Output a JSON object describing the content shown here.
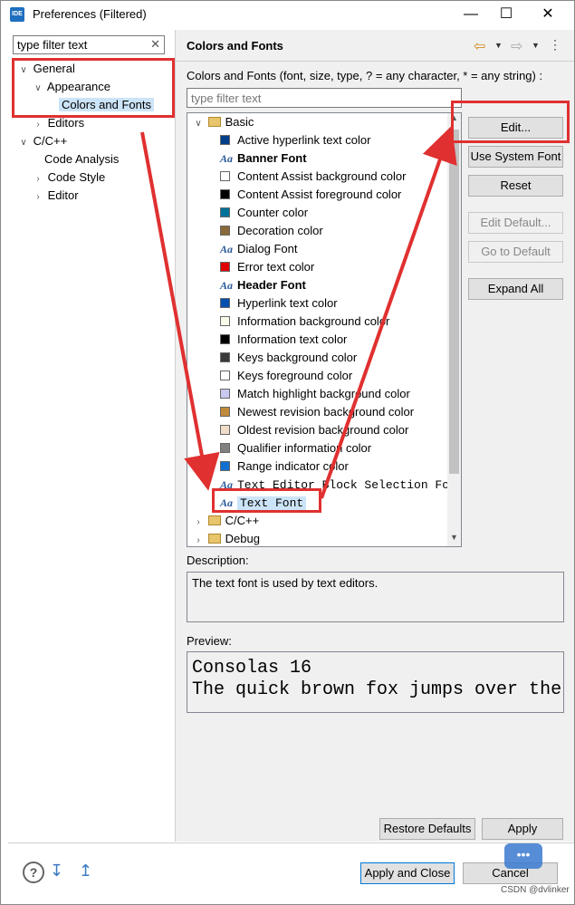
{
  "window": {
    "title": "Preferences (Filtered)",
    "icon_text": "IDE"
  },
  "left": {
    "filter_value": "type filter text",
    "tree": [
      {
        "label": "General",
        "level": 0,
        "expanded": true
      },
      {
        "label": "Appearance",
        "level": 1,
        "expanded": true
      },
      {
        "label": "Colors and Fonts",
        "level": 2,
        "selected": true
      },
      {
        "label": "Editors",
        "level": 1,
        "expanded": false
      },
      {
        "label": "C/C++",
        "level": 0,
        "expanded": true
      },
      {
        "label": "Code Analysis",
        "level": 1
      },
      {
        "label": "Code Style",
        "level": 1,
        "expanded": false
      },
      {
        "label": "Editor",
        "level": 1,
        "expanded": false
      }
    ]
  },
  "right": {
    "header": "Colors and Fonts",
    "subtitle": "Colors and Fonts (font, size, type, ? = any character, * = any string) :",
    "filter_placeholder": "type filter text",
    "basic_label": "Basic",
    "items": [
      {
        "label": "Active hyperlink text color",
        "type": "color",
        "color": "#003f8a"
      },
      {
        "label": "Banner Font",
        "type": "font",
        "bold": true
      },
      {
        "label": "Content Assist background color",
        "type": "color",
        "color": "#ffffff"
      },
      {
        "label": "Content Assist foreground color",
        "type": "color",
        "color": "#000000"
      },
      {
        "label": "Counter color",
        "type": "color",
        "color": "#00729a"
      },
      {
        "label": "Decoration color",
        "type": "color",
        "color": "#8a6a3a"
      },
      {
        "label": "Dialog Font",
        "type": "font"
      },
      {
        "label": "Error text color",
        "type": "color",
        "color": "#e00000"
      },
      {
        "label": "Header Font",
        "type": "font",
        "bold": true
      },
      {
        "label": "Hyperlink text color",
        "type": "color",
        "color": "#0050b0"
      },
      {
        "label": "Information background color",
        "type": "color",
        "color": "#fafae8"
      },
      {
        "label": "Information text color",
        "type": "color",
        "color": "#000000"
      },
      {
        "label": "Keys background color",
        "type": "color",
        "color": "#3a3a3a"
      },
      {
        "label": "Keys foreground color",
        "type": "color",
        "color": "#ffffff"
      },
      {
        "label": "Match highlight background color",
        "type": "color",
        "color": "#c8c8f0"
      },
      {
        "label": "Newest revision background color",
        "type": "color",
        "color": "#c08a3a"
      },
      {
        "label": "Oldest revision background color",
        "type": "color",
        "color": "#f0dcc8"
      },
      {
        "label": "Qualifier information color",
        "type": "color",
        "color": "#808080"
      },
      {
        "label": "Range indicator color",
        "type": "color",
        "color": "#1070d0"
      },
      {
        "label": "Text Editor Block Selection Font",
        "type": "font",
        "mono": true
      },
      {
        "label": "Text Font",
        "type": "font",
        "mono": true,
        "selected": true
      }
    ],
    "groups_after": [
      "C/C++",
      "Debug"
    ],
    "buttons": {
      "edit": "Edit...",
      "use_system_font": "Use System Font",
      "reset": "Reset",
      "edit_default": "Edit Default...",
      "go_to_default": "Go to Default",
      "expand_all": "Expand All"
    },
    "description_label": "Description:",
    "description_text": "The text font is used by text editors.",
    "preview_label": "Preview:",
    "preview_lines": [
      "Consolas 16",
      "The quick brown fox jumps over the"
    ],
    "restore_defaults": "Restore Defaults",
    "apply": "Apply"
  },
  "footer": {
    "apply_and_close": "Apply and Close",
    "cancel": "Cancel",
    "watermark": "CSDN @dvlinker"
  }
}
